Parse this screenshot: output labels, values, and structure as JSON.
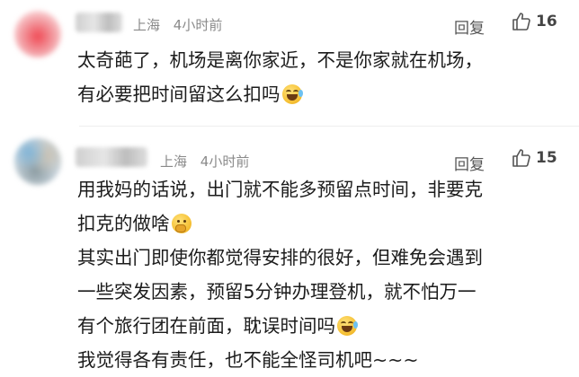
{
  "comments": [
    {
      "location": "上海",
      "time": "4小时前",
      "reply_label": "回复",
      "like_count": "16",
      "lines": [
        "太奇葩了，机场是离你家近，不是你家就在机场，",
        "有必要把时间留这么扣吗"
      ]
    },
    {
      "location": "上海",
      "time": "4小时前",
      "reply_label": "回复",
      "like_count": "15",
      "lines": [
        "用我妈的话说，出门就不能多预留点时间，非要克",
        "扣克的做啥",
        "其实出门即使你都觉得安排的很好，但难免会遇到",
        "一些突发因素，预留5分钟办理登机，就不怕万一",
        "有个旅行团在前面，耽误时间吗",
        "我觉得各有责任，也不能全怪司机吧~~~"
      ]
    }
  ],
  "icons": {
    "like": "thumbs-up-outline-icon",
    "laugh": "laughing-tears-emoji-icon",
    "think": "thinking-emoji-icon"
  },
  "colors": {
    "meta_text": "#8a8a8a",
    "body_text": "#1c1c1c"
  }
}
